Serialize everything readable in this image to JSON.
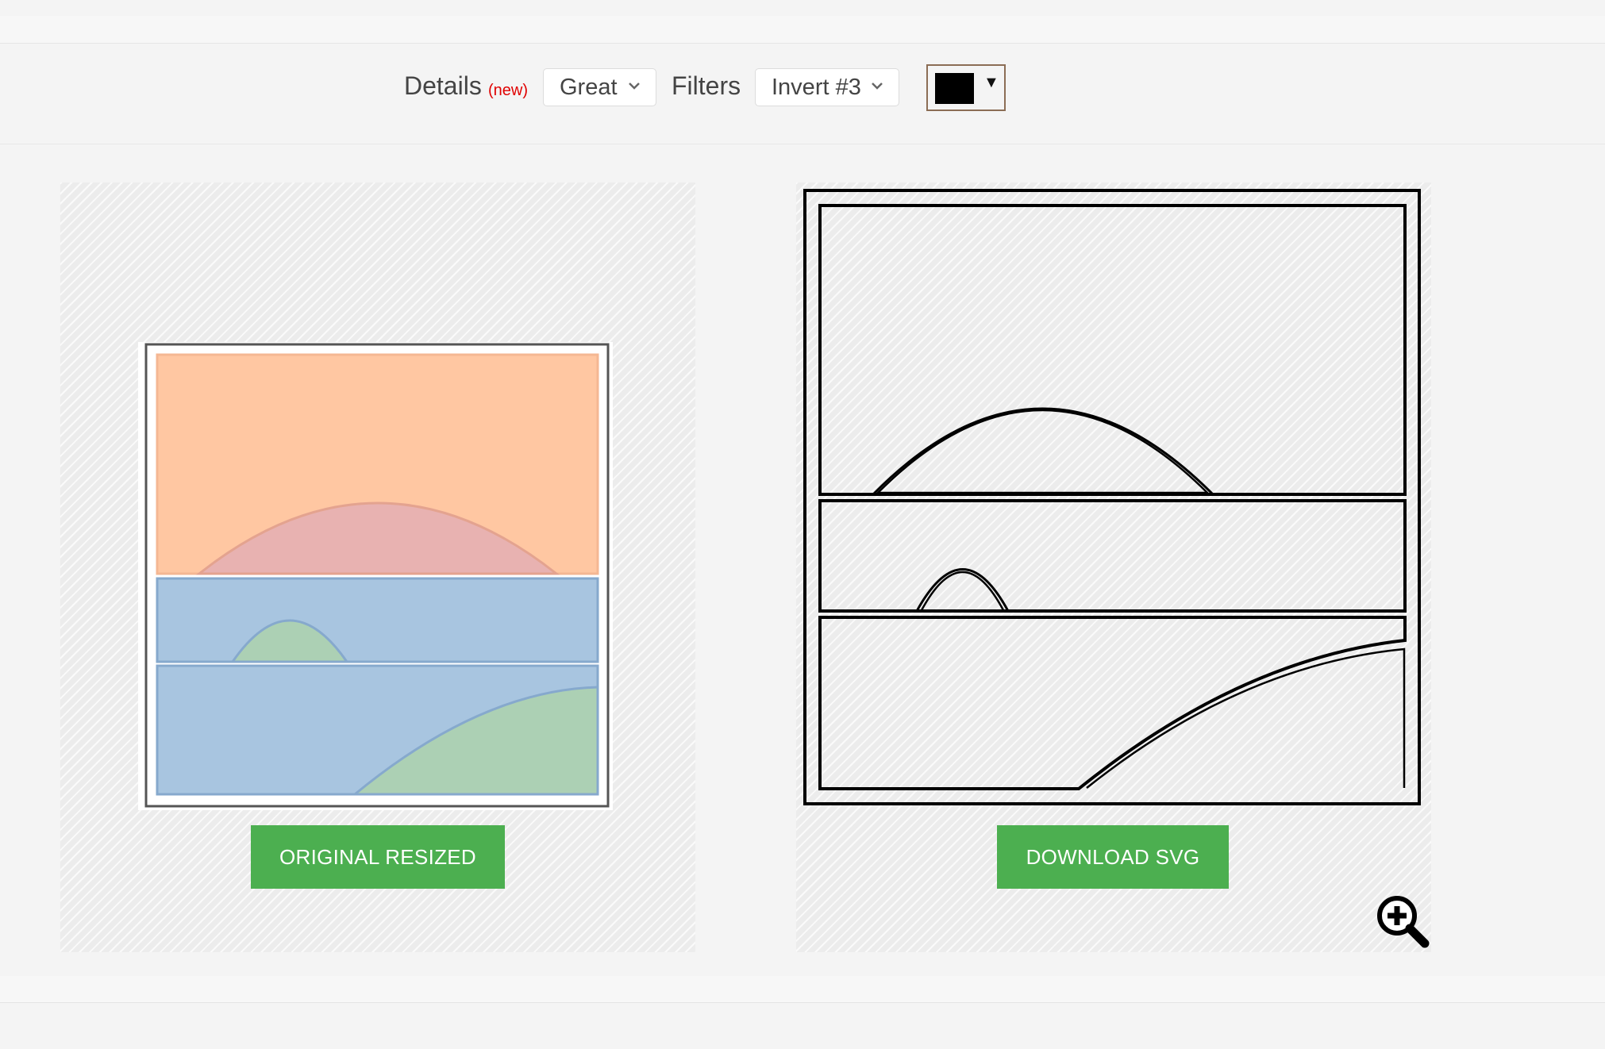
{
  "toolbar": {
    "details_label": "Details",
    "details_new": "(new)",
    "details_select": "Great",
    "filters_label": "Filters",
    "filters_select": "Invert #3",
    "color_swatch": "#000000",
    "color_arrow": "▼"
  },
  "preview": {
    "original_button": "ORIGINAL RESIZED",
    "download_button": "DOWNLOAD SVG"
  },
  "icons": {
    "zoom": "zoom-in-icon",
    "chevron": "chevron-down-icon",
    "dropdown": "triangle-down-icon"
  },
  "colors": {
    "accent_green": "#4caf50",
    "sky": "#ffc7a2",
    "sun": "#e8b2b1",
    "water": "#a8c5e0",
    "hill": "#acd0b4",
    "new_badge": "#e00000"
  }
}
